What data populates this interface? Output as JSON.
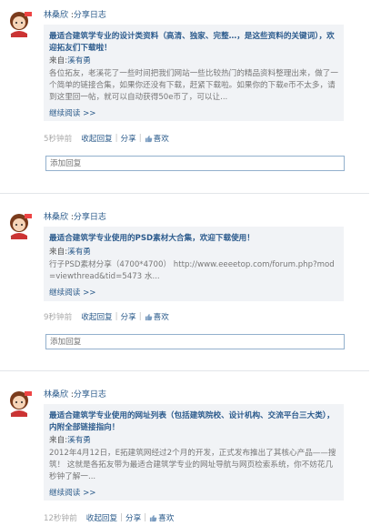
{
  "posts": [
    {
      "author": "林桑欣",
      "type": "分享日志",
      "title": "最适合建筑学专业的设计类资料（高清、独家、完整…，是这些资料的关键词），欢迎拓友们下载啦！",
      "source_label": "来自:",
      "source_name": "溪有勇",
      "excerpt": "各位拓友，老溪花了一些时间把我们网站一些比较热门的精品资料整理出来，做了一个简单的链接合集，如果你还没有下载，赶紧下载啦。如果你的下载e币不太多，请到这里回一帖，就可以自动获得50e币了，可以让...",
      "more": "继续阅读 >>",
      "time": "5秒钟前",
      "reply": "收起回复",
      "share": "分享",
      "like": "喜欢",
      "reply_placeholder": "添加回复"
    },
    {
      "author": "林桑欣",
      "type": "分享日志",
      "title": "最适合建筑学专业使用的PSD素材大合集，欢迎下载使用！",
      "source_label": "来自:",
      "source_name": "溪有勇",
      "excerpt": "行子PSD素材分享（4700*4700） http://www.eeeetop.com/forum.php?mod=viewthread&tid=5473 水...",
      "more": "继续阅读 >>",
      "time": "9秒钟前",
      "reply": "收起回复",
      "share": "分享",
      "like": "喜欢",
      "reply_placeholder": "添加回复"
    },
    {
      "author": "林桑欣",
      "type": "分享日志",
      "title": "最适合建筑学专业使用的网址列表（包括建筑院校、设计机构、交流平台三大类），内附全部链接指向！",
      "source_label": "来自:",
      "source_name": "溪有勇",
      "excerpt": "2012年4月12日，E拓建筑网经过2个月的开发，正式发布推出了其核心产品——搜筑！ 这就是各拓友带为最适合建筑学专业的网址导航与网页检索系统，你不妨花几秒钟了解一...",
      "more": "继续阅读 >>",
      "time": "12秒钟前",
      "reply": "收起回复",
      "share": "分享",
      "like": "喜欢"
    }
  ],
  "colors": {
    "link": "#2a5a8a",
    "card_bg": "#f1f3f6",
    "reply_border": "#93b0cd"
  },
  "icons": {
    "avatar": "cartoon-avatar",
    "like": "thumbs-up-icon"
  }
}
